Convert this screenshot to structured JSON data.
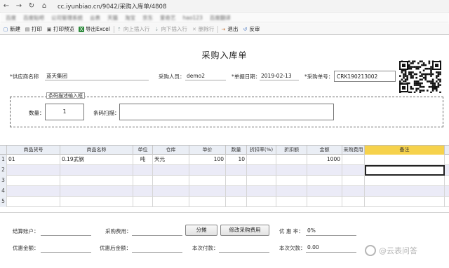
{
  "browser": {
    "url": "cc.iyunbiao.cn/9042/采购入库单/4808"
  },
  "bookmarks": [
    "百度",
    "百度贴吧",
    "公司管理系统",
    "云表",
    "天猫",
    "淘宝",
    "京东",
    "爱奇艺",
    "hao123",
    "百度翻译"
  ],
  "toolbar": {
    "items": [
      {
        "label": "新建",
        "icon": "new-file-icon",
        "enabled": true
      },
      {
        "label": "打印",
        "icon": "printer-icon",
        "enabled": true
      },
      {
        "label": "打印预览",
        "icon": "print-preview-icon",
        "enabled": true
      },
      {
        "label": "导出Excel",
        "icon": "excel-icon",
        "enabled": true
      },
      {
        "label": "向上插入行",
        "icon": "insert-above-icon",
        "enabled": false
      },
      {
        "label": "向下插入行",
        "icon": "insert-below-icon",
        "enabled": false
      },
      {
        "label": "删除行",
        "icon": "delete-row-icon",
        "enabled": false
      },
      {
        "label": "退出",
        "icon": "exit-icon",
        "enabled": true
      },
      {
        "label": "反审",
        "icon": "unaudit-icon",
        "enabled": true
      }
    ]
  },
  "form": {
    "title": "采购入库单",
    "supplier_label": "*供应商名称",
    "supplier_value": "蓝天集团",
    "purchaser_label": "采购人员：",
    "purchaser_value": "demo2",
    "date_label": "*单据日期：",
    "date_value": "2019-02-13",
    "order_no_label": "*采购单号：",
    "order_no_value": "CRK190213002",
    "barcode_legend": "条码描述输入框",
    "qty_label": "数量：",
    "qty_value": "1",
    "scan_label": "条码扫描：",
    "scan_value": ""
  },
  "grid": {
    "columns": [
      "商品货号",
      "商品名称",
      "单位",
      "仓库",
      "单价",
      "数量",
      "折扣率(%)",
      "折扣额",
      "金额",
      "采购费用",
      "备注"
    ],
    "rows": [
      {
        "num": "1",
        "cells": [
          "01",
          "0.19武钢",
          "吨",
          "天元",
          "100",
          "10",
          "",
          "",
          "1000",
          "",
          ""
        ]
      },
      {
        "num": "2",
        "cells": [
          "",
          "",
          "",
          "",
          "",
          "",
          "",
          "",
          "",
          "",
          ""
        ]
      },
      {
        "num": "3",
        "cells": [
          "",
          "",
          "",
          "",
          "",
          "",
          "",
          "",
          "",
          "",
          ""
        ]
      },
      {
        "num": "4",
        "cells": [
          "",
          "",
          "",
          "",
          "",
          "",
          "",
          "",
          "",
          "",
          ""
        ]
      },
      {
        "num": "5",
        "cells": [
          "",
          "",
          "",
          "",
          "",
          "",
          "",
          "",
          "",
          "",
          ""
        ]
      }
    ]
  },
  "footer": {
    "settle_account_label": "结算账户：",
    "purchase_fee_label": "采购费用：",
    "split_button": "分摊",
    "modify_fee_button": "修改采购费用",
    "discount_rate_label": "优 惠 率：",
    "discount_rate_value": "0%",
    "discount_amount_label": "优惠金额：",
    "after_discount_label": "优惠后金额：",
    "paid_label": "本次付款：",
    "owed_label": "本次欠款：",
    "owed_value": "0.00"
  },
  "watermark": "@云表问答",
  "colors": {
    "remark_header": "#f6d24c",
    "alt_row": "#ebebf7",
    "grid_header": "#eaeef5"
  }
}
